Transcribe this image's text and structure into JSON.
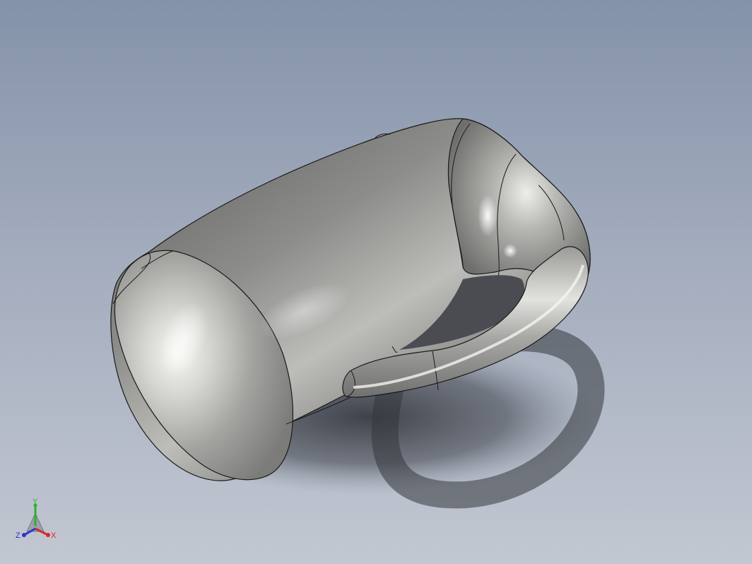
{
  "viewport": {
    "background_top": "#8492a9",
    "background_bottom": "#c2c7d1",
    "model": "mug-model",
    "model_color": "#a8a8a6",
    "edge_color": "#1a1a1a"
  },
  "triad": {
    "x_label": "X",
    "y_label": "Y",
    "z_label": "Z",
    "x_color": "#d8282a",
    "y_color": "#2fae2f",
    "z_color": "#2a36c8"
  }
}
